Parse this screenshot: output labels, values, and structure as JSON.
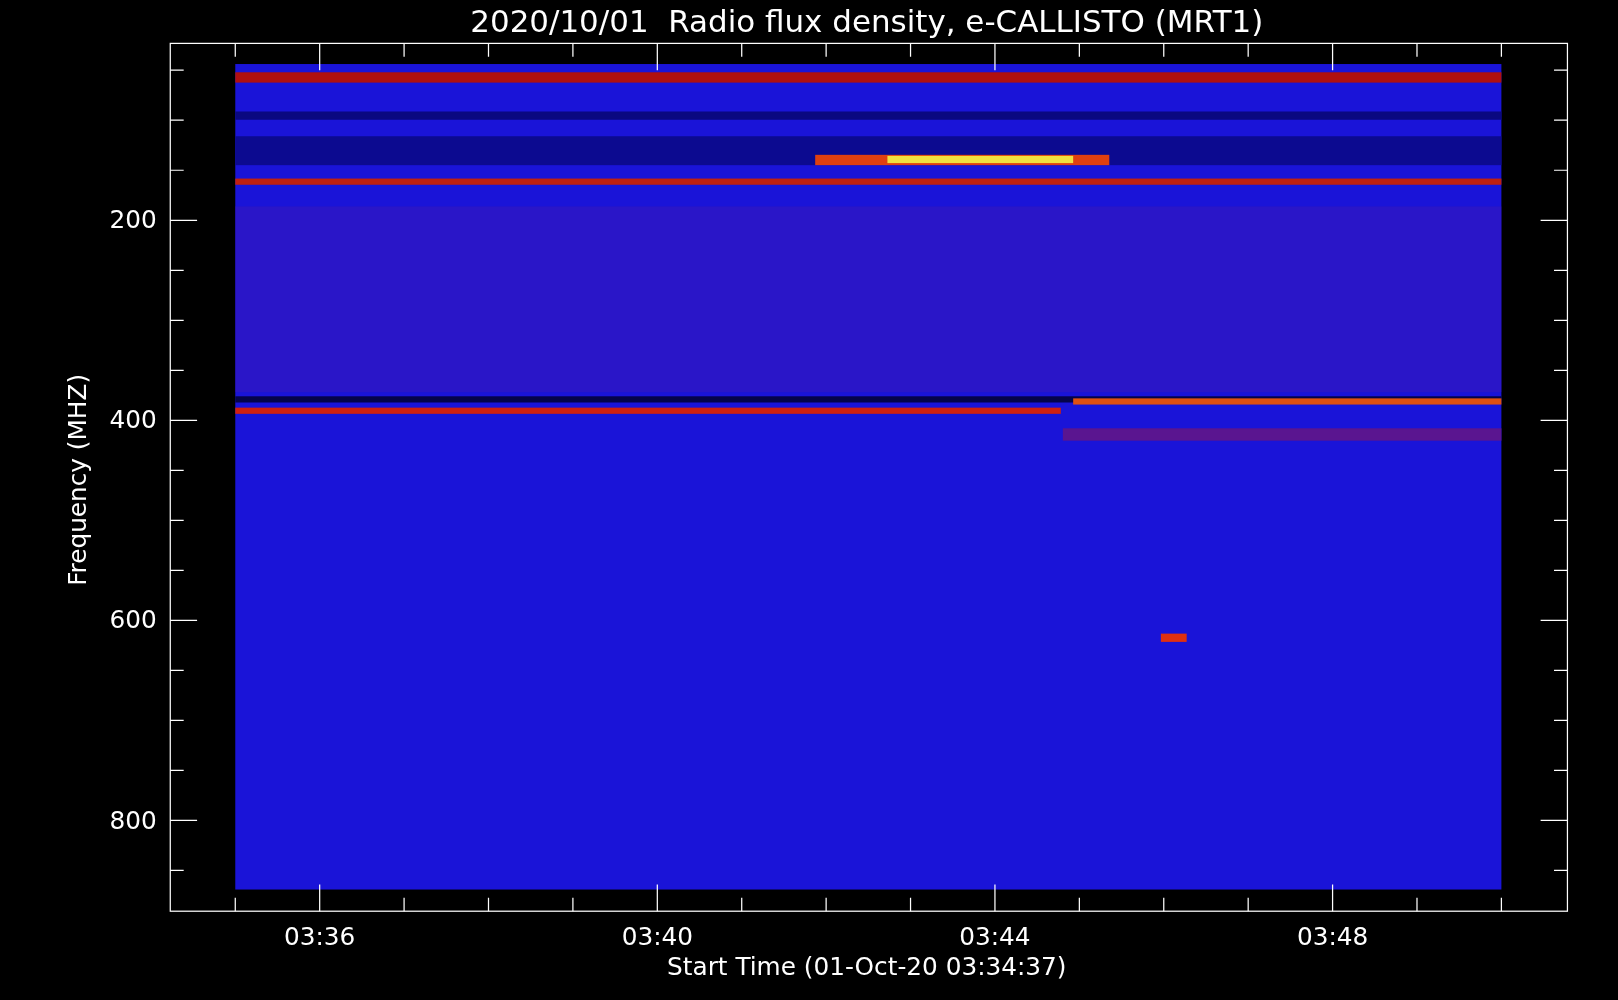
{
  "plot": {
    "title": "2020/10/01  Radio flux density, e-CALLISTO (MRT1)",
    "x_axis": {
      "label": "Start Time (01-Oct-20 03:34:37)",
      "ticks": [
        "03:36",
        "03:40",
        "03:44",
        "03:48"
      ]
    },
    "y_axis": {
      "label": "Frequency (MHZ)",
      "ticks": [
        "200",
        "400",
        "600",
        "800"
      ]
    }
  }
}
